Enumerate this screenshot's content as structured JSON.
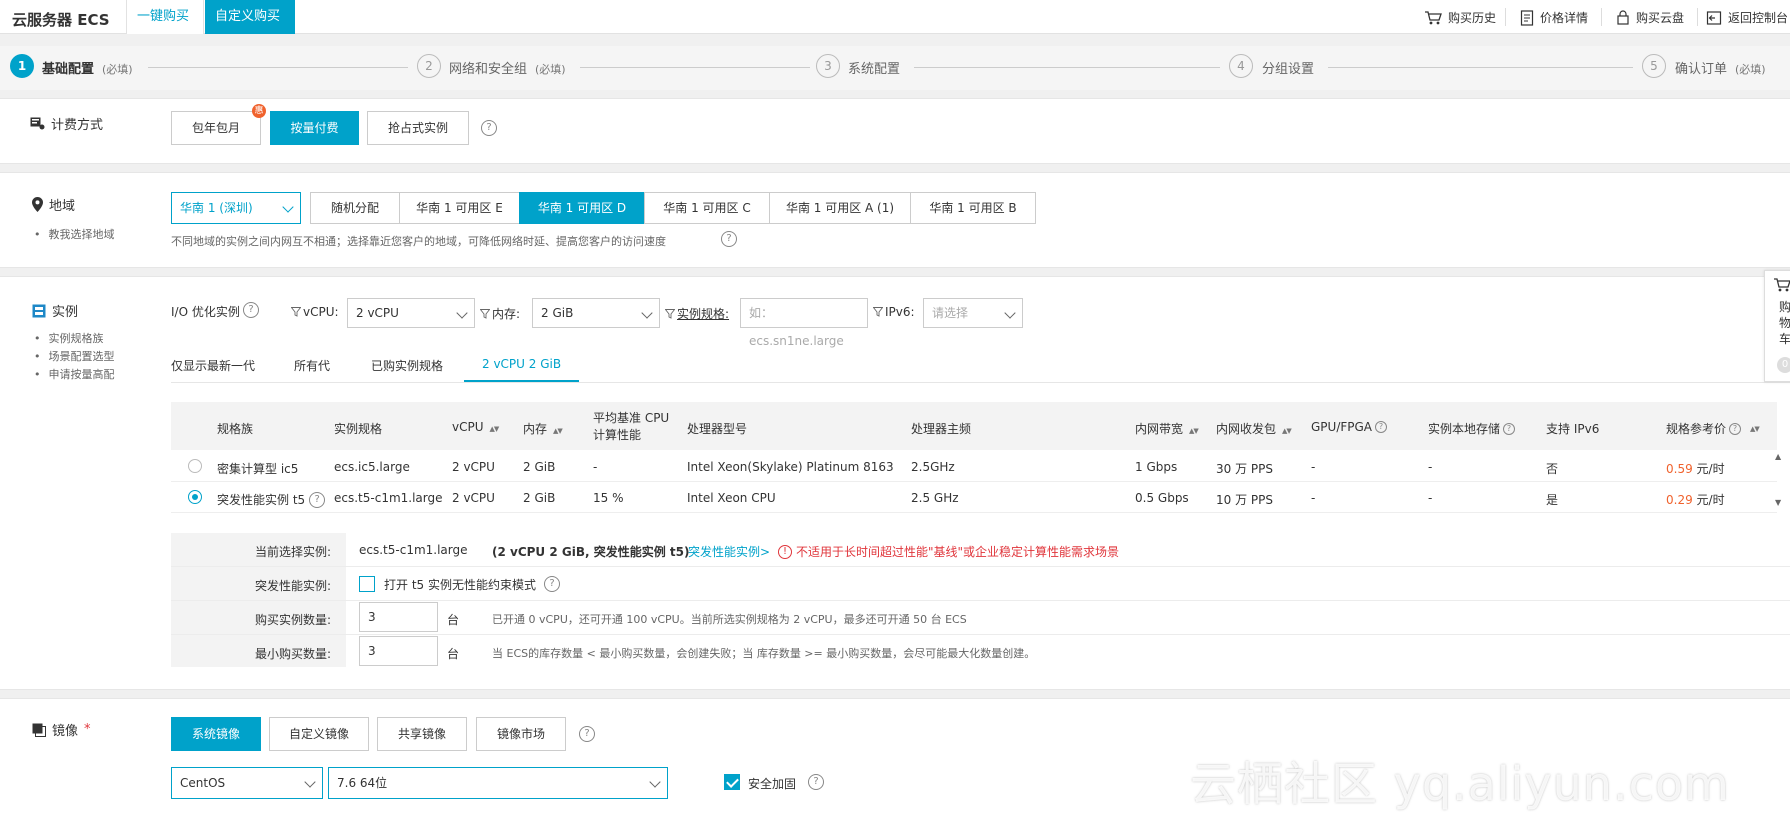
{
  "topbar": {
    "brand": "云服务器 ECS",
    "tab_quick": "一键购买",
    "tab_custom": "自定义购买",
    "links": [
      "购买历史",
      "价格详情",
      "购买云盘",
      "返回控制台"
    ]
  },
  "steps": [
    {
      "num": "1",
      "label": "基础配置",
      "hint": "(必填)"
    },
    {
      "num": "2",
      "label": "网络和安全组",
      "hint": "(必填)"
    },
    {
      "num": "3",
      "label": "系统配置",
      "hint": ""
    },
    {
      "num": "4",
      "label": "分组设置",
      "hint": ""
    },
    {
      "num": "5",
      "label": "确认订单",
      "hint": "(必填)"
    }
  ],
  "billing": {
    "title": "计费方式",
    "options": [
      "包年包月",
      "按量付费",
      "抢占式实例"
    ],
    "badge": "惠"
  },
  "region": {
    "title": "地域",
    "side_link": "教我选择地域",
    "select": "华南 1 (深圳)",
    "zones": [
      "随机分配",
      "华南 1 可用区 E",
      "华南 1 可用区 D",
      "华南 1 可用区 C",
      "华南 1 可用区 A (1)",
      "华南 1 可用区 B"
    ],
    "note": "不同地域的实例之间内网互不相通；选择靠近您客户的地域，可降低网络时延、提高您客户的访问速度"
  },
  "instance": {
    "title": "实例",
    "side_links": [
      "实例规格族",
      "场景配置选型",
      "申请按量高配"
    ],
    "filters": {
      "io": "I/O 优化实例",
      "vcpu_label": "vCPU:",
      "vcpu_value": "2 vCPU",
      "mem_label": "内存:",
      "mem_value": "2 GiB",
      "spec_label": "实例规格:",
      "spec_placeholder": "如：ecs.sn1ne.large",
      "ipv6_label": "IPv6:",
      "ipv6_placeholder": "请选择"
    },
    "tabs": [
      "仅显示最新一代",
      "所有代",
      "已购实例规格",
      "2 vCPU 2 GiB"
    ],
    "columns": [
      "规格族",
      "实例规格",
      "vCPU",
      "内存",
      "平均基准 CPU 计算性能",
      "处理器型号",
      "处理器主频",
      "内网带宽",
      "内网收发包",
      "GPU/FPGA",
      "实例本地存储",
      "支持 IPv6",
      "规格参考价"
    ],
    "rows": [
      {
        "family": "密集计算型 ic5",
        "spec": "ecs.ic5.large",
        "vcpu": "2 vCPU",
        "mem": "2 GiB",
        "baseline": "-",
        "cpu": "Intel Xeon(Skylake) Platinum 8163",
        "freq": "2.5GHz",
        "bw": "1 Gbps",
        "pps": "30 万 PPS",
        "gpu": "-",
        "storage": "-",
        "ipv6": "否",
        "price": "0.59",
        "unit": "元/时"
      },
      {
        "family": "突发性能实例 t5",
        "spec": "ecs.t5-c1m1.large",
        "vcpu": "2 vCPU",
        "mem": "2 GiB",
        "baseline": "15 %",
        "cpu": "Intel Xeon CPU",
        "freq": "2.5 GHz",
        "bw": "0.5 Gbps",
        "pps": "10 万 PPS",
        "gpu": "-",
        "storage": "-",
        "ipv6": "是",
        "price": "0.29",
        "unit": "元/时"
      }
    ],
    "summary": {
      "current_label": "当前选择实例:",
      "current_spec": "ecs.t5-c1m1.large",
      "current_desc": "(2 vCPU 2 GiB, 突发性能实例 t5)",
      "current_link": "突发性能实例>",
      "warning": "不适用于长时间超过性能\"基线\"或企业稳定计算性能需求场景",
      "burst_label": "突发性能实例:",
      "burst_option": "打开 t5 实例无性能约束模式",
      "qty_label": "购买实例数量:",
      "qty_value": "3",
      "qty_unit": "台",
      "qty_note": "已开通 0 vCPU，还可开通 100 vCPU。当前所选实例规格为 2 vCPU，最多还可开通 50 台 ECS",
      "min_label": "最小购买数量:",
      "min_value": "3",
      "min_unit": "台",
      "min_note": "当 ECS的库存数量 < 最小购买数量，会创建失败；当 库存数量 >= 最小购买数量，会尽可能最大化数量创建。"
    }
  },
  "cart": {
    "text": "购物车",
    "count": "0"
  },
  "image": {
    "title": "镜像",
    "required": "*",
    "tabs": [
      "系统镜像",
      "自定义镜像",
      "共享镜像",
      "镜像市场"
    ],
    "os": "CentOS",
    "version": "7.6 64位",
    "secure": "安全加固"
  },
  "watermark": "云栖社区 yq.aliyun.com"
}
